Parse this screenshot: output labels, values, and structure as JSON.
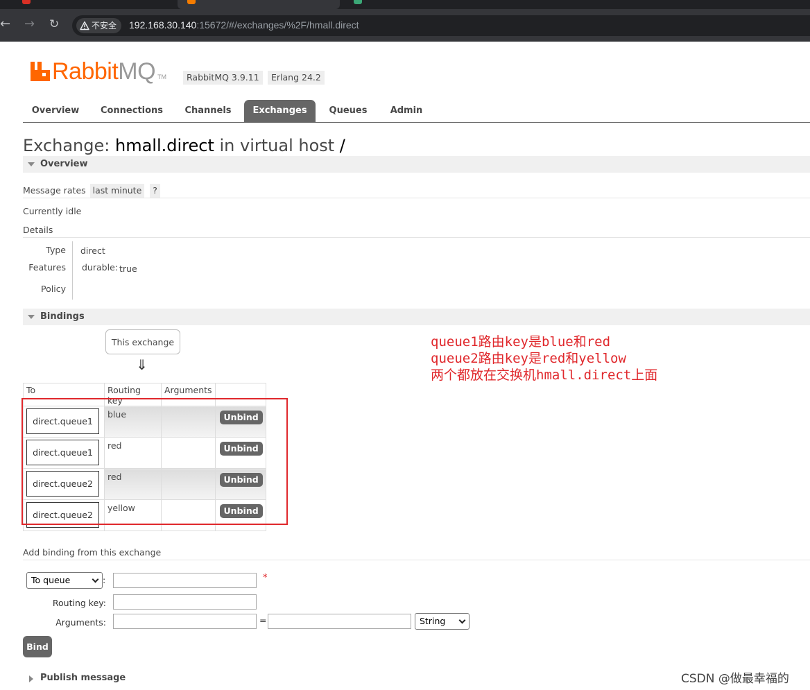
{
  "browser": {
    "security_label": "不安全",
    "url_host": "192.168.30.140",
    "url_rest": ":15672/#/exchanges/%2F/hmall.direct"
  },
  "header": {
    "logo_rabbit": "Rabbit",
    "logo_mq": "MQ",
    "logo_tm": "TM",
    "rabbitmq_version": "RabbitMQ 3.9.11",
    "erlang_version": "Erlang 24.2"
  },
  "nav": {
    "items": [
      "Overview",
      "Connections",
      "Channels",
      "Exchanges",
      "Queues",
      "Admin"
    ],
    "active": "Exchanges"
  },
  "title": {
    "prefix": "Exchange: ",
    "name": "hmall.direct",
    "middle": " in virtual host ",
    "vhost": "/"
  },
  "overview": {
    "heading": "Overview",
    "message_rates_label": "Message rates",
    "message_rates_value": "last minute",
    "help": "?",
    "status": "Currently idle",
    "details_label": "Details",
    "type_label": "Type",
    "type_value": "direct",
    "features_label": "Features",
    "features_key": "durable:",
    "features_value": "true",
    "policy_label": "Policy"
  },
  "bindings": {
    "heading": "Bindings",
    "source_label": "This exchange",
    "arrow": "⇓",
    "columns": [
      "To",
      "Routing key",
      "Arguments",
      ""
    ],
    "rows": [
      {
        "to": "direct.queue1",
        "routing_key": "blue",
        "arguments": "",
        "action": "Unbind"
      },
      {
        "to": "direct.queue1",
        "routing_key": "red",
        "arguments": "",
        "action": "Unbind"
      },
      {
        "to": "direct.queue2",
        "routing_key": "red",
        "arguments": "",
        "action": "Unbind"
      },
      {
        "to": "direct.queue2",
        "routing_key": "yellow",
        "arguments": "",
        "action": "Unbind"
      }
    ]
  },
  "annotation": {
    "lines": [
      "queue1路由key是blue和red",
      "queue2路由key是red和yellow",
      "两个都放在交换机hmall.direct上面"
    ],
    "color": "#e0282c"
  },
  "add_binding": {
    "heading": "Add binding from this exchange",
    "destination_type": "To queue",
    "destination_value": "",
    "required_marker": "*",
    "routing_key_label": "Routing key:",
    "routing_key_value": "",
    "arguments_label": "Arguments:",
    "argument_key": "",
    "equals": "=",
    "argument_value": "",
    "argument_type": "String",
    "colon": ":",
    "bind_label": "Bind"
  },
  "publish_message": "Publish message",
  "watermark": "CSDN @做最幸福的"
}
